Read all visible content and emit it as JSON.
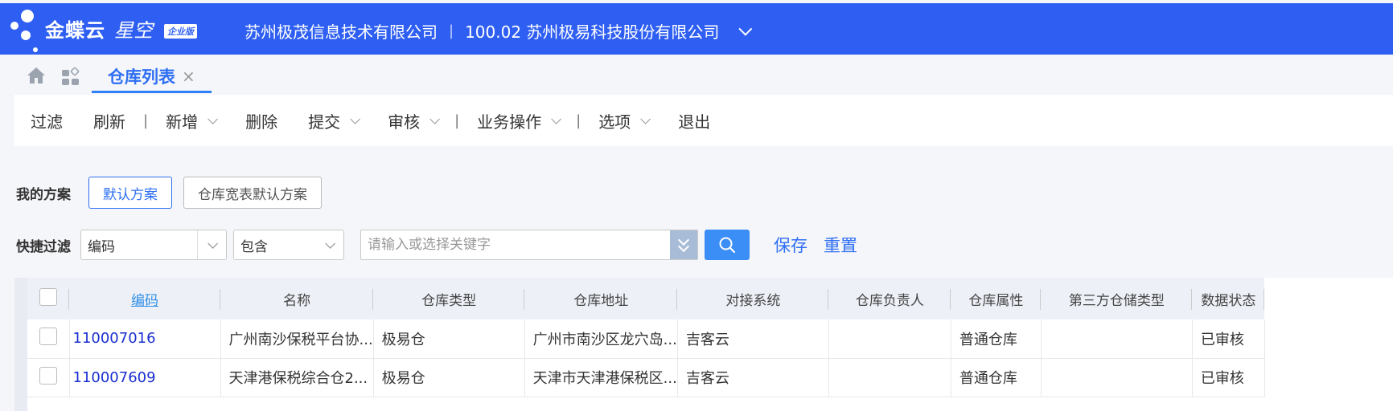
{
  "brand": {
    "name": "金蝶云",
    "product": "星空",
    "edition": "企业版"
  },
  "header": {
    "company": "苏州极茂信息技术有限公司",
    "org": "100.02 苏州极易科技股份有限公司"
  },
  "tabs": [
    {
      "label": "仓库列表",
      "close": "×"
    }
  ],
  "toolbar": {
    "filter": "过滤",
    "refresh": "刷新",
    "add": "新增",
    "delete": "删除",
    "submit": "提交",
    "audit": "审核",
    "business": "业务操作",
    "options": "选项",
    "exit": "退出"
  },
  "schemes": {
    "title": "我的方案",
    "items": [
      "默认方案",
      "仓库宽表默认方案"
    ]
  },
  "quick_filter": {
    "title": "快捷过滤",
    "field": "编码",
    "operator": "包含",
    "keyword_placeholder": "请输入或选择关键字",
    "save": "保存",
    "reset": "重置"
  },
  "table": {
    "columns": [
      "编码",
      "名称",
      "仓库类型",
      "仓库地址",
      "对接系统",
      "仓库负责人",
      "仓库属性",
      "第三方仓储类型",
      "数据状态"
    ],
    "rows": [
      [
        "110007016",
        "广州南沙保税平台协...",
        "极易仓",
        "广州市南沙区龙穴岛...",
        "吉客云",
        "",
        "普通仓库",
        "",
        "已审核"
      ],
      [
        "110007609",
        "天津港保税综合仓2...",
        "极易仓",
        "天津市天津港保税区...",
        "吉客云",
        "",
        "普通仓库",
        "",
        "已审核"
      ]
    ]
  },
  "colors": {
    "header_bg": "#2f5ff2",
    "accent": "#2f6ff3",
    "link_code": "#1a2fd0"
  }
}
